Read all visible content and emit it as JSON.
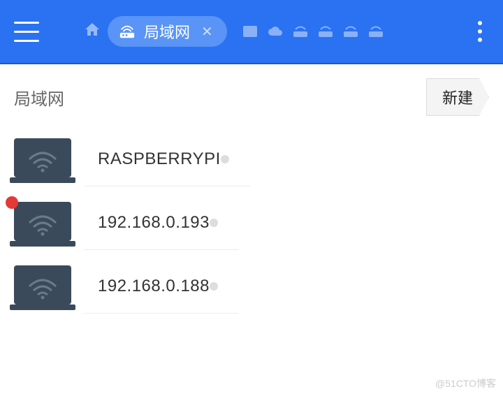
{
  "header": {
    "tab_label": "局域网"
  },
  "subheader": {
    "title": "局域网",
    "new_button": "新建"
  },
  "devices": [
    {
      "name": "RASPBERRYPI",
      "alert": false
    },
    {
      "name": "192.168.0.193",
      "alert": true
    },
    {
      "name": "192.168.0.188",
      "alert": false
    }
  ],
  "watermark": "@51CTO博客"
}
